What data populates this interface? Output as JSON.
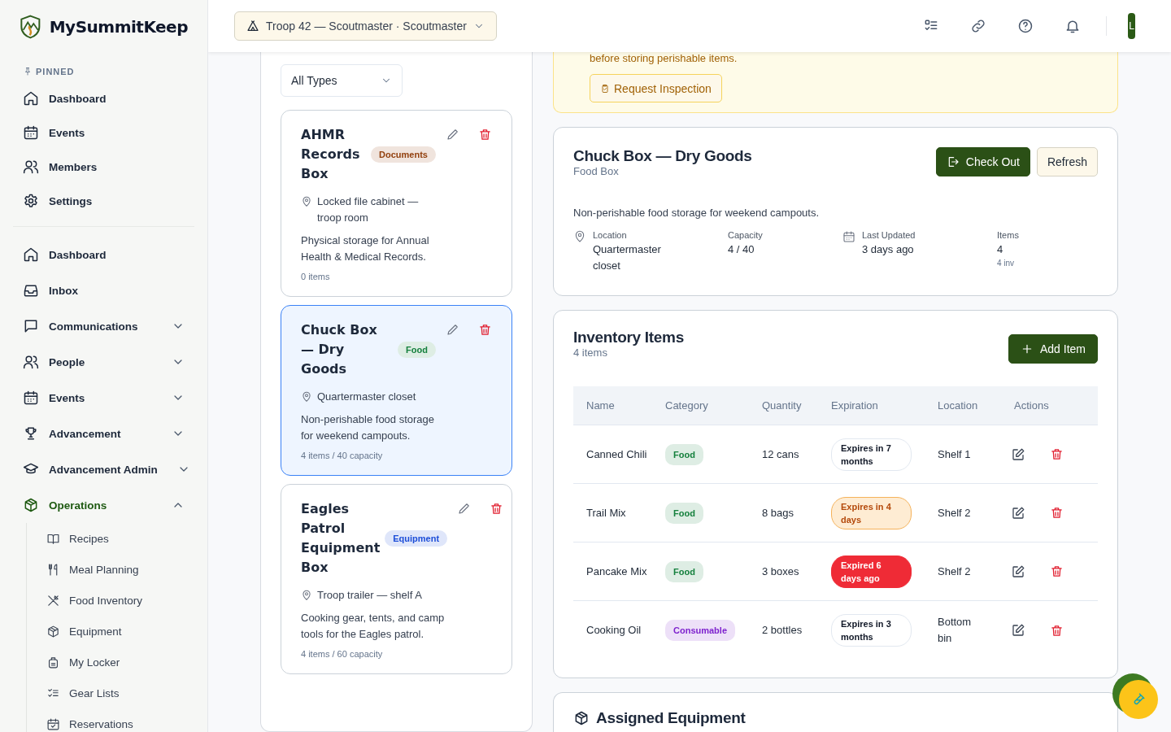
{
  "app": {
    "name": "MySummitKeep"
  },
  "sidebar": {
    "pinned_label": "PINNED",
    "pinned": [
      {
        "label": "Dashboard"
      },
      {
        "label": "Events"
      },
      {
        "label": "Members"
      },
      {
        "label": "Settings"
      }
    ],
    "items": [
      {
        "label": "Dashboard",
        "kind": "link",
        "selected": false
      },
      {
        "label": "Inbox",
        "kind": "link",
        "selected": false
      },
      {
        "label": "Communications",
        "kind": "group",
        "expanded": false,
        "selected": false
      },
      {
        "label": "People",
        "kind": "group",
        "expanded": false,
        "selected": false
      },
      {
        "label": "Events",
        "kind": "group",
        "expanded": false,
        "selected": false
      },
      {
        "label": "Advancement",
        "kind": "group",
        "expanded": false,
        "selected": false
      },
      {
        "label": "Advancement Admin",
        "kind": "group",
        "expanded": false,
        "selected": false
      },
      {
        "label": "Operations",
        "kind": "group",
        "expanded": true,
        "selected": true,
        "children": [
          {
            "label": "Recipes",
            "selected": false
          },
          {
            "label": "Meal Planning",
            "selected": false
          },
          {
            "label": "Food Inventory",
            "selected": false
          },
          {
            "label": "Equipment",
            "selected": false
          },
          {
            "label": "My Locker",
            "selected": false
          },
          {
            "label": "Gear Lists",
            "selected": false
          },
          {
            "label": "Reservations",
            "selected": false
          }
        ]
      }
    ]
  },
  "header": {
    "unit_selector": "Troop 42 — Scoutmaster · Scoutmaster",
    "avatar": "L"
  },
  "box_list": {
    "filter": "All Types",
    "boxes": [
      {
        "title": "AHMR Records Box",
        "tag": {
          "label": "Documents",
          "color": "#92400e"
        },
        "location": "Locked file cabinet — troop room",
        "description": "Physical storage for Annual Health & Medical Records.",
        "meta": "0 items",
        "selected": false
      },
      {
        "title": "Chuck Box — Dry Goods",
        "tag": {
          "label": "Food",
          "color": "#15803d"
        },
        "location": "Quartermaster closet",
        "description": "Non-perishable food storage for weekend campouts.",
        "meta": "4 items / 40 capacity",
        "selected": true
      },
      {
        "title": "Eagles Patrol Equipment Box",
        "tag": {
          "label": "Equipment",
          "color": "#1d4ed8"
        },
        "location": "Troop trailer — shelf A",
        "description": "Cooking gear, tents, and camp tools for the Eagles patrol.",
        "meta": "4 items / 60 capacity",
        "selected": false
      }
    ]
  },
  "notice": {
    "text": "before storing perishable items.",
    "button": "Request Inspection"
  },
  "detail": {
    "title": "Chuck Box — Dry Goods",
    "subtitle": "Food Box",
    "check_out": "Check Out",
    "refresh": "Refresh",
    "description": "Non-perishable food storage for weekend campouts.",
    "facts": [
      {
        "label": "Location",
        "value": "Quartermaster closet"
      },
      {
        "label": "Capacity",
        "value": "4 / 40"
      },
      {
        "label": "Last Updated",
        "value": "3 days ago"
      },
      {
        "label": "Items",
        "value": "4",
        "note": "4 inv"
      }
    ]
  },
  "inventory": {
    "title": "Inventory Items",
    "count": "4 items",
    "add_button": "Add Item",
    "columns": [
      "Name",
      "Category",
      "Quantity",
      "Expiration",
      "Location",
      "Actions"
    ],
    "rows": [
      {
        "name": "Canned Chili",
        "category": {
          "label": "Food",
          "color": "#15803d"
        },
        "quantity": "12 cans",
        "expiration": {
          "label": "Expires in 7 months",
          "kind": "ok"
        },
        "location": "Shelf 1"
      },
      {
        "name": "Trail Mix",
        "category": {
          "label": "Food",
          "color": "#15803d"
        },
        "quantity": "8 bags",
        "expiration": {
          "label": "Expires in 4 days",
          "kind": "warning"
        },
        "location": "Shelf 2"
      },
      {
        "name": "Pancake Mix",
        "category": {
          "label": "Food",
          "color": "#15803d"
        },
        "quantity": "3 boxes",
        "expiration": {
          "label": "Expired 6 days ago",
          "kind": "expired"
        },
        "location": "Shelf 2"
      },
      {
        "name": "Cooking Oil",
        "category": {
          "label": "Consumable",
          "color": "#7e22ce"
        },
        "quantity": "2 bottles",
        "expiration": {
          "label": "Expires in 3 months",
          "kind": "ok"
        },
        "location": "Bottom bin"
      }
    ]
  },
  "assigned": {
    "title": "Assigned Equipment"
  }
}
